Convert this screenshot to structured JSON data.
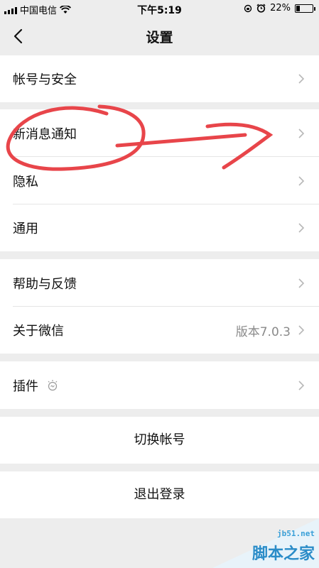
{
  "status_bar": {
    "carrier": "中国电信",
    "time": "下午5:19",
    "battery": "22%",
    "battery_level": 0.22
  },
  "nav": {
    "title": "设置"
  },
  "menu": {
    "account_security": "帐号与安全",
    "new_message_notify": "新消息通知",
    "privacy": "隐私",
    "general": "通用",
    "help_feedback": "帮助与反馈",
    "about": "关于微信",
    "about_version": "版本7.0.3",
    "plugins": "插件"
  },
  "buttons": {
    "switch_account": "切换帐号",
    "logout": "退出登录"
  },
  "watermark": {
    "url": "jb51.net",
    "text": "脚本之家"
  },
  "colors": {
    "annotation": "#e8454a",
    "background": "#ededed"
  },
  "icons": [
    "signal-icon",
    "wifi-icon",
    "alarm-icon",
    "battery-icon",
    "back-icon",
    "chevron-right-icon",
    "plugin-bulb-icon"
  ]
}
